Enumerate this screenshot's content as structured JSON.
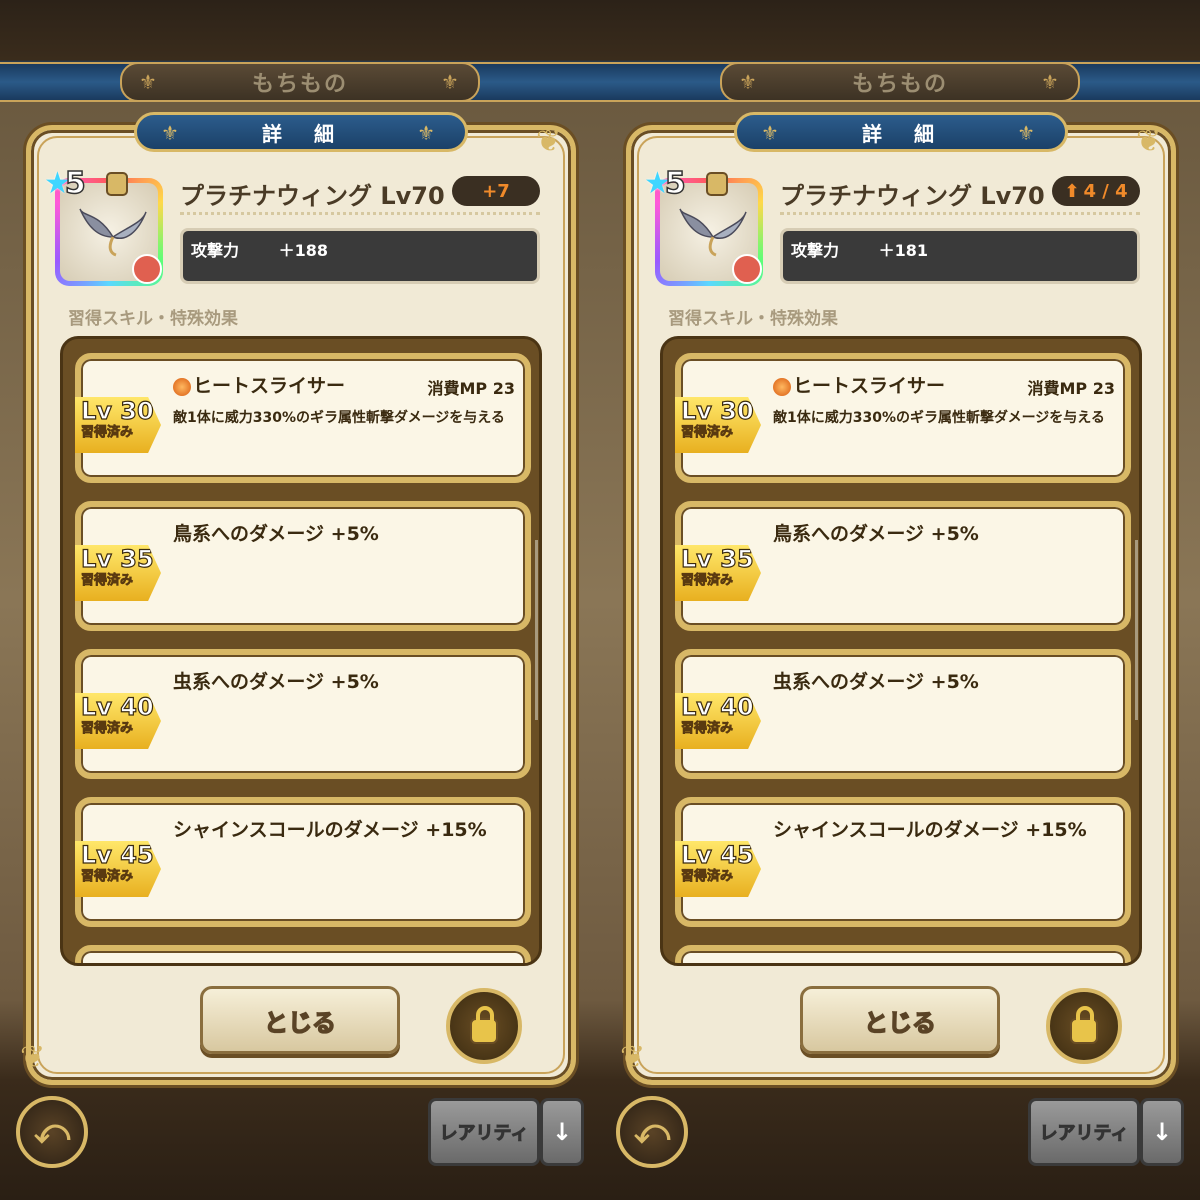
{
  "screens": [
    {
      "top_title": "もちもの",
      "header_title": "詳　細",
      "item": {
        "stars": "5",
        "name": "プラチナウィング Lv70",
        "upgrade_badge": "+7",
        "stat_label": "攻撃力",
        "stat_value": "＋188"
      },
      "section_title": "習得スキル・特殊効果",
      "skills": [
        {
          "lv": "Lv 30",
          "status": "習得済み",
          "title": "ヒートスライサー",
          "mp": "消費MP 23",
          "desc": "敵1体に威力330%のギラ属性斬撃ダメージを与える"
        },
        {
          "lv": "Lv 35",
          "status": "習得済み",
          "title": "鳥系へのダメージ +5%",
          "mp": "",
          "desc": ""
        },
        {
          "lv": "Lv 40",
          "status": "習得済み",
          "title": "虫系へのダメージ +5%",
          "mp": "",
          "desc": ""
        },
        {
          "lv": "Lv 45",
          "status": "習得済み",
          "title": "シャインスコールのダメージ +15%",
          "mp": "",
          "desc": ""
        }
      ],
      "close_label": "とじる",
      "sort_label": "レアリティ",
      "sort_arrow": "↓",
      "back_icon": "⤺"
    },
    {
      "top_title": "もちもの",
      "header_title": "詳　細",
      "item": {
        "stars": "5",
        "name": "プラチナウィング Lv70",
        "upgrade_badge": "4 / 4",
        "stat_label": "攻撃力",
        "stat_value": "＋181"
      },
      "section_title": "習得スキル・特殊効果",
      "skills": [
        {
          "lv": "Lv 30",
          "status": "習得済み",
          "title": "ヒートスライサー",
          "mp": "消費MP 23",
          "desc": "敵1体に威力330%のギラ属性斬撃ダメージを与える"
        },
        {
          "lv": "Lv 35",
          "status": "習得済み",
          "title": "鳥系へのダメージ +5%",
          "mp": "",
          "desc": ""
        },
        {
          "lv": "Lv 40",
          "status": "習得済み",
          "title": "虫系へのダメージ +5%",
          "mp": "",
          "desc": ""
        },
        {
          "lv": "Lv 45",
          "status": "習得済み",
          "title": "シャインスコールのダメージ +15%",
          "mp": "",
          "desc": ""
        }
      ],
      "close_label": "とじる",
      "sort_label": "レアリティ",
      "sort_arrow": "↓",
      "back_icon": "⤺"
    }
  ],
  "colors": {
    "accent_gold": "#d8b866",
    "header_blue": "#1b4168",
    "badge_orange": "#f08a2a"
  }
}
